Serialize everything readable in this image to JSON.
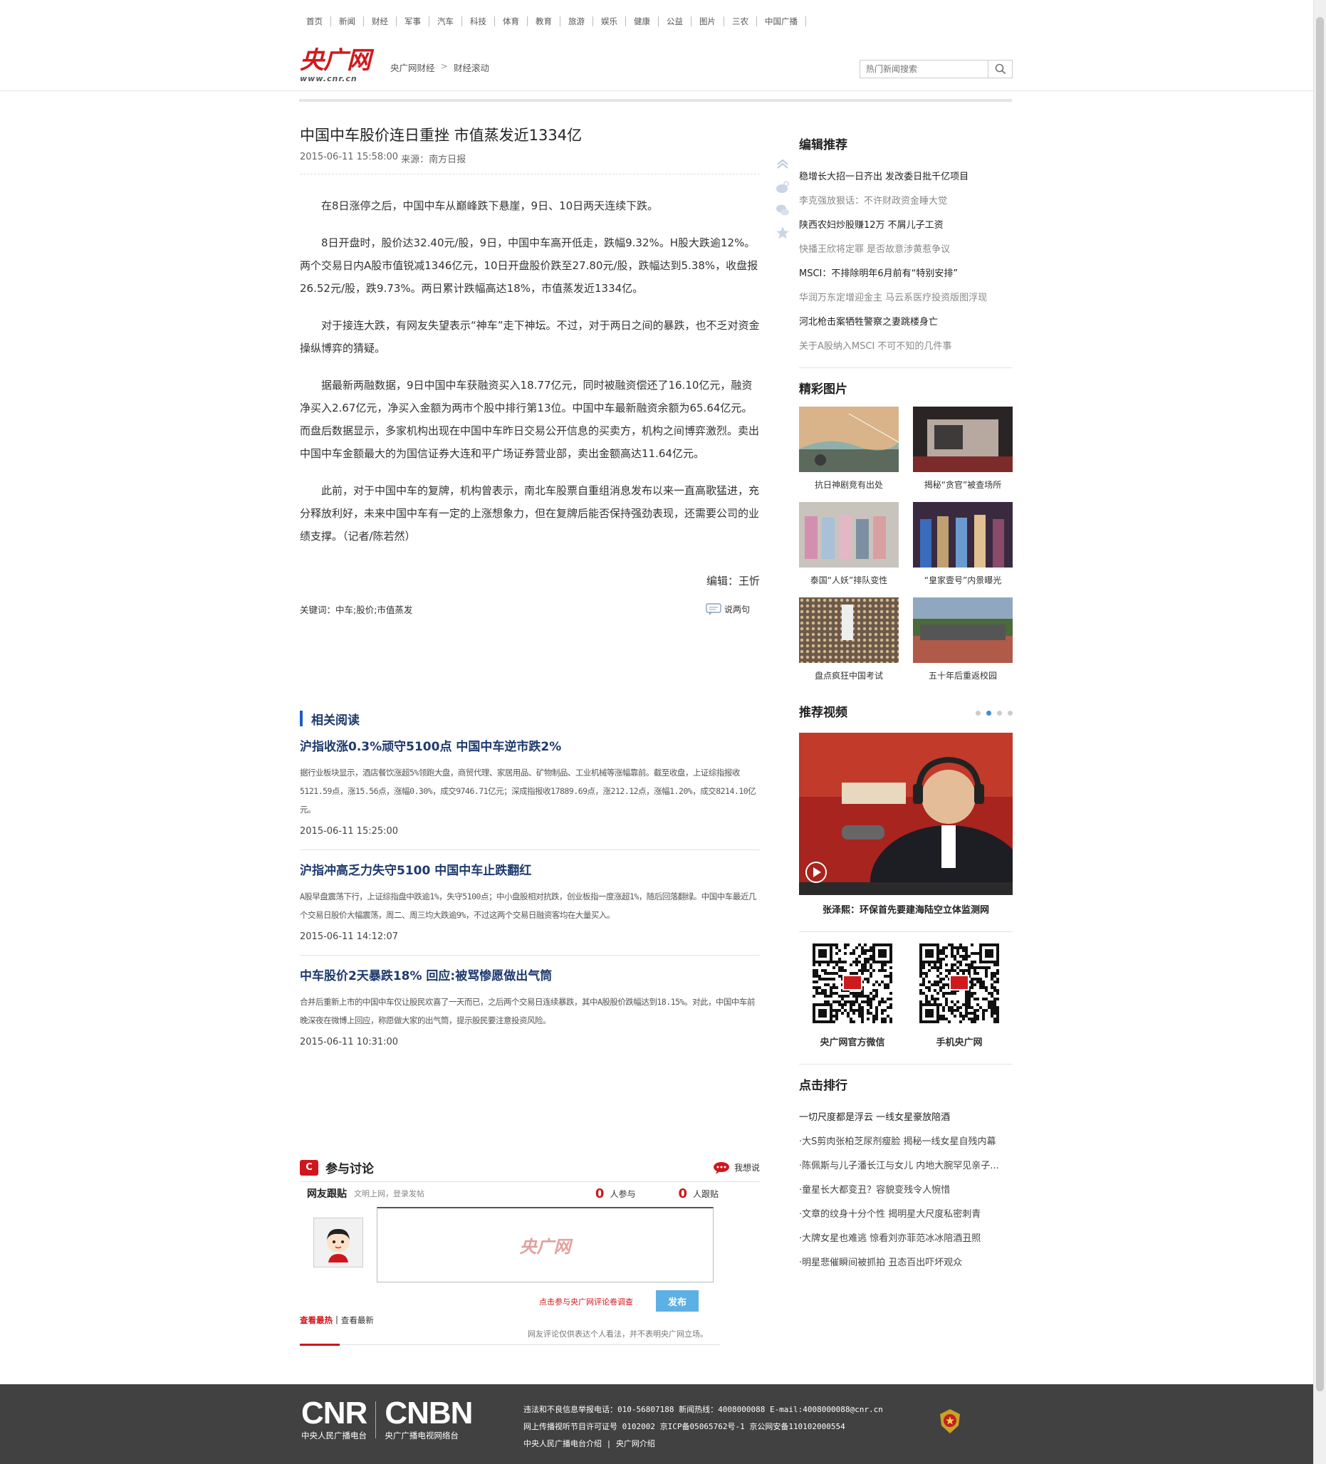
{
  "topnav": [
    "首页",
    "新闻",
    "财经",
    "军事",
    "汽车",
    "科技",
    "体育",
    "教育",
    "旅游",
    "娱乐",
    "健康",
    "公益",
    "图片",
    "三农",
    "中国广播"
  ],
  "logo": {
    "main": "央广网",
    "sub": "www.cnr.cn"
  },
  "breadcrumb": [
    "央广网财经",
    "财经滚动"
  ],
  "search": {
    "placeholder": "热门新闻搜索"
  },
  "article": {
    "title": "中国中车股价连日重挫 市值蒸发近1334亿",
    "datetime": "2015-06-11 15:58:00",
    "source_label": "来源：",
    "source": "南方日报",
    "paragraphs": [
      "在8日涨停之后，中国中车从巅峰跌下悬崖，9日、10日两天连续下跌。",
      "8日开盘时，股价达32.40元/股，9日，中国中车高开低走，跌幅9.32%。H股大跌逾12%。两个交易日内A股市值锐减1346亿元，10日开盘股价跌至27.80元/股，跌幅达到5.38%，收盘报26.52元/股，跌9.73%。两日累计跌幅高达18%，市值蒸发近1334亿。",
      "对于接连大跌，有网友失望表示“神车”走下神坛。不过，对于两日之间的暴跌，也不乏对资金操纵博弈的猜疑。",
      "据最新两融数据，9日中国中车获融资买入18.77亿元，同时被融资偿还了16.10亿元，融资净买入2.67亿元，净买入金额为两市个股中排行第13位。中国中车最新融资余额为65.64亿元。而盘后数据显示，多家机构出现在中国中车昨日交易公开信息的买卖方，机构之间博弈激烈。卖出中国中车金额最大的为国信证券大连和平广场证券营业部，卖出金额高达11.64亿元。",
      "此前，对于中国中车的复牌，机构曾表示，南北车股票自重组消息发布以来一直高歌猛进，充分释放利好，未来中国中车有一定的上涨想象力，但在复牌后能否保持强劲表现，还需要公司的业绩支撑。（记者/陈若然）"
    ],
    "editor": "编辑：王忻",
    "keywords": "关键词：中车;股价;市值蒸发",
    "comment_link": "说两句"
  },
  "related": {
    "title": "相关阅读",
    "items": [
      {
        "title": "沪指收涨0.3%顽守5100点 中国中车逆市跌2%",
        "summary": "据行业板块显示，酒店餐饮涨超5%领跑大盘，商贸代理、家居用品、矿物制品、工业机械等涨幅靠前。截至收盘，上证综指报收5121.59点，涨15.56点，涨幅0.30%，成交9746.71亿元；深成指报收17889.69点，涨212.12点，涨幅1.20%，成交8214.10亿元。",
        "date": "2015-06-11 15:25:00"
      },
      {
        "title": "沪指冲高乏力失守5100 中国中车止跌翻红",
        "summary": "A股早盘震荡下行，上证综指盘中跌逾1%，失守5100点；中小盘股相对抗跌，创业板指一度涨超1%，随后回落翻绿。中国中车最近几个交易日股价大幅震荡，周二、周三均大跌逾9%，不过这两个交易日融资客均在大量买入。",
        "date": "2015-06-11 14:12:07"
      },
      {
        "title": "中车股价2天暴跌18% 回应:被骂惨愿做出气筒",
        "summary": "合并后重新上市的中国中车仅让股民欢喜了一天而已，之后两个交易日连续暴跌，其中A股股价跌幅达到18.15%。对此，中国中车前晚深夜在微博上回应，称愿做大家的出气筒，提示股民要注意投资风险。",
        "date": "2015-06-11 10:31:00"
      }
    ]
  },
  "discuss": {
    "title": "参与讨论",
    "want": "我想说",
    "follow_label": "网友跟贴",
    "follow_hint": "文明上网，登录发帖",
    "participants": "0",
    "participants_label": "人参与",
    "followers": "0",
    "followers_label": "人跟贴",
    "watermark": "央广网",
    "survey": "点击参与央广网评论卷调查",
    "publish": "发布",
    "sort_hot": "查看最热",
    "sort_sep": "|",
    "sort_new": "查看最新",
    "disclaimer": "网友评论仅供表达个人看法，并不表明央广网立场。"
  },
  "sidebar": {
    "editor_picks_title": "编辑推荐",
    "editor_picks": [
      {
        "text": "稳增长大招一日齐出 发改委日批千亿项目",
        "grey": false
      },
      {
        "text": "李克强放狠话：不许财政资金睡大觉",
        "grey": true
      },
      {
        "text": "陕西农妇炒股赚12万 不屑儿子工资",
        "grey": false
      },
      {
        "text": "快播王欣将定罪 是否故意涉黄惹争议",
        "grey": true
      },
      {
        "text": "MSCI：不排除明年6月前有“特别安排”",
        "grey": false
      },
      {
        "text": "华润万东定增迎金主 马云系医疗投资版图浮现",
        "grey": true
      },
      {
        "text": "河北枪击案牺牲警察之妻跳楼身亡",
        "grey": false
      },
      {
        "text": "关于A股纳入MSCI 不可不知的几件事",
        "grey": true
      }
    ],
    "pics_title": "精彩图片",
    "pics": [
      "抗日神剧竞有出处",
      "揭秘“贪官”被查场所",
      "泰国“人妖”排队变性",
      "“皇家壹号”内景曝光",
      "盘点疯狂中国考试",
      "五十年后重返校园"
    ],
    "video_title": "推荐视频",
    "video_caption": "张泽熙：环保首先要建海陆空立体监测网",
    "qr": [
      "央广网官方微信",
      "手机央广网"
    ],
    "hot_title": "点击排行",
    "hot": [
      "一切尺度都是浮云 一线女星豪放陪酒",
      "·大S剪肉张柏芝尿剂瘦脸 揭秘一线女星自残内幕",
      "·陈佩斯与儿子潘长江与女儿 内地大腕罕见亲子...",
      "·童星长大都变丑？容貌变残令人惋惜",
      "·文章的纹身十分个性 揭明星大尺度私密刺青",
      "·大牌女星也难逃 惊看刘亦菲范冰冰陪酒丑照",
      "·明星悲催瞬间被抓拍 丑态百出吓坏观众"
    ]
  },
  "footer": {
    "cnr": "CNR",
    "cnr_sub": "中央人民广播电台",
    "cnbn": "CNBN",
    "cnbn_sub": "央广广播电视网络台",
    "lines": [
      "违法和不良信息举报电话：010-56807188 新闻热线：4008000088 E-mail:4008000088@cnr.cn",
      "网上传播视听节目许可证号 0102002 京ICP备05065762号-1 京公网安备110102000554",
      "中央人民广播电台介绍 | 央广网介绍"
    ]
  },
  "colors": {
    "brand_red": "#cf1a1d",
    "link_blue": "#1e3a6e",
    "accent_blue": "#1b5fbf",
    "footer_bg": "#414141",
    "publish_btn": "#5db0e4"
  }
}
